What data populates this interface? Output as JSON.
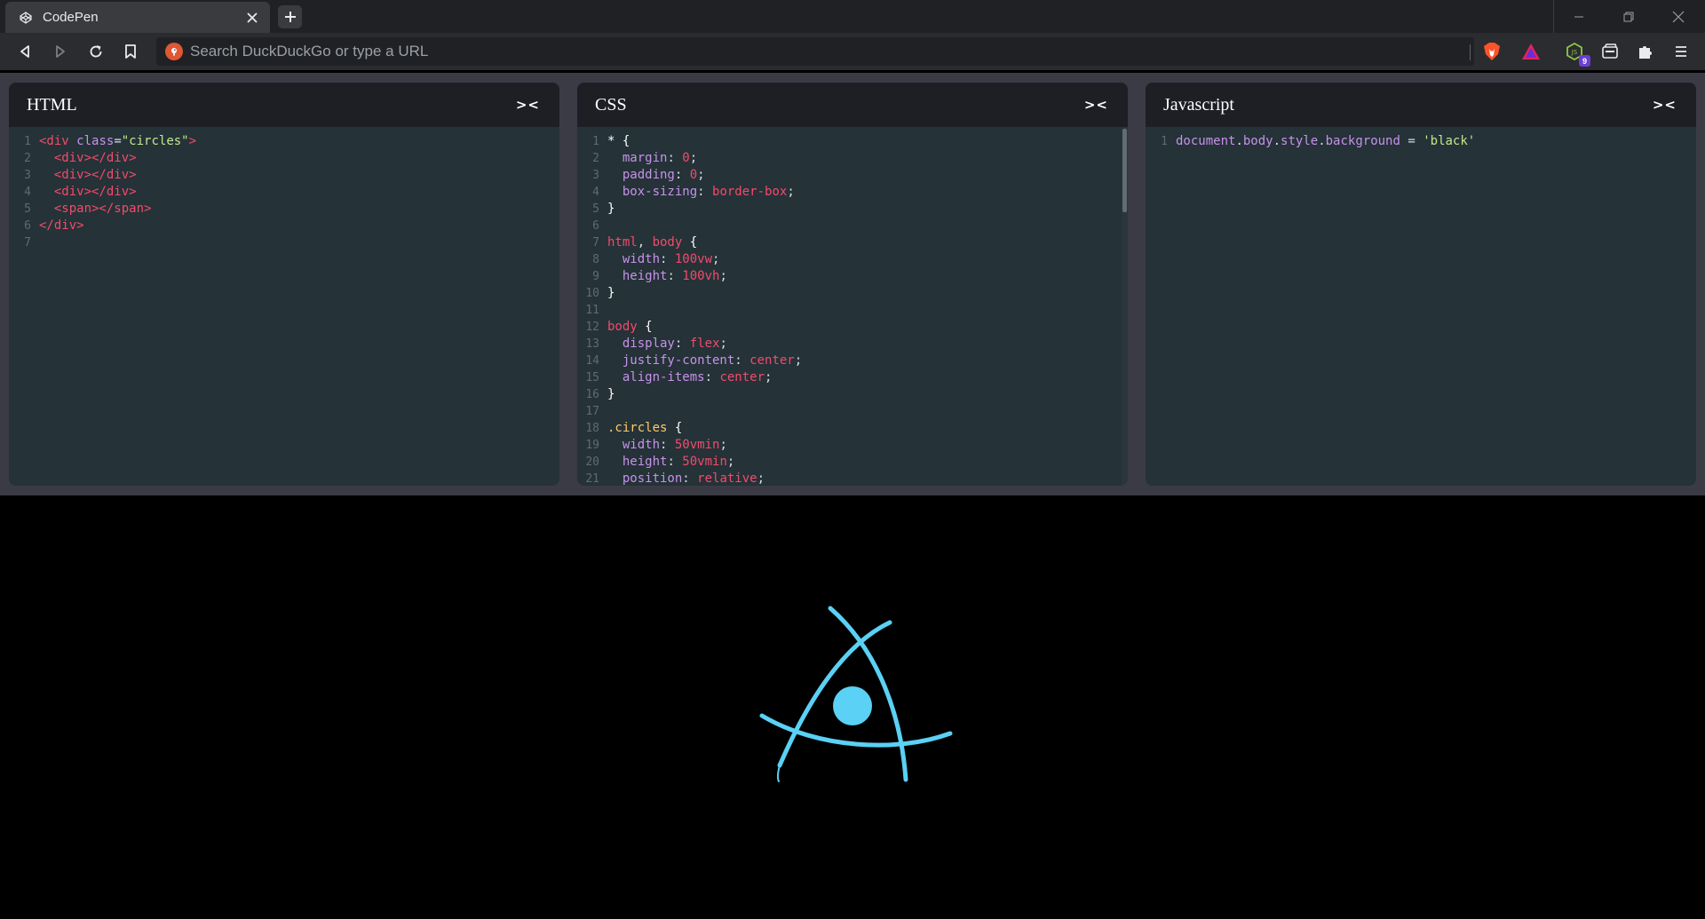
{
  "browser": {
    "tab": {
      "title": "CodePen",
      "favicon": "codepen-icon"
    },
    "url_placeholder": "Search DuckDuckGo or type a URL",
    "extension_badge": "9",
    "colors": {
      "tab_bg": "#3a3b3e",
      "toolbar_bg": "#2b2c2f",
      "tabbar_bg": "#202124"
    }
  },
  "panels": {
    "html": {
      "title": "HTML",
      "collapse_label": "><",
      "lines": [
        {
          "n": "1",
          "parts": [
            [
              "t-tag",
              "<div "
            ],
            [
              "t-attr",
              "class"
            ],
            [
              "t-pun",
              "="
            ],
            [
              "t-str",
              "\"circles\""
            ],
            [
              "t-tag",
              ">"
            ]
          ]
        },
        {
          "n": "2",
          "parts": [
            [
              "t-tag",
              "  <div></div>"
            ]
          ]
        },
        {
          "n": "3",
          "parts": [
            [
              "t-tag",
              "  <div></div>"
            ]
          ]
        },
        {
          "n": "4",
          "parts": [
            [
              "t-tag",
              "  <div></div>"
            ]
          ]
        },
        {
          "n": "5",
          "parts": [
            [
              "t-tag",
              "  <span></span>"
            ]
          ]
        },
        {
          "n": "6",
          "parts": [
            [
              "t-tag",
              "</div>"
            ]
          ]
        },
        {
          "n": "7",
          "parts": []
        }
      ]
    },
    "css": {
      "title": "CSS",
      "collapse_label": "><",
      "lines": [
        {
          "n": "1",
          "parts": [
            [
              "t-brace",
              "* {"
            ]
          ]
        },
        {
          "n": "2",
          "parts": [
            [
              "t-prop",
              "  margin"
            ],
            [
              "t-pun",
              ": "
            ],
            [
              "t-val",
              "0"
            ],
            [
              "t-pun",
              ";"
            ]
          ]
        },
        {
          "n": "3",
          "parts": [
            [
              "t-prop",
              "  padding"
            ],
            [
              "t-pun",
              ": "
            ],
            [
              "t-val",
              "0"
            ],
            [
              "t-pun",
              ";"
            ]
          ]
        },
        {
          "n": "4",
          "parts": [
            [
              "t-prop",
              "  box-sizing"
            ],
            [
              "t-pun",
              ": "
            ],
            [
              "t-val",
              "border-box"
            ],
            [
              "t-pun",
              ";"
            ]
          ]
        },
        {
          "n": "5",
          "parts": [
            [
              "t-brace",
              "}"
            ]
          ]
        },
        {
          "n": "6",
          "parts": []
        },
        {
          "n": "7",
          "parts": [
            [
              "t-sel",
              "html"
            ],
            [
              "t-pun",
              ", "
            ],
            [
              "t-sel",
              "body"
            ],
            [
              "t-brace",
              " {"
            ]
          ]
        },
        {
          "n": "8",
          "parts": [
            [
              "t-prop",
              "  width"
            ],
            [
              "t-pun",
              ": "
            ],
            [
              "t-val",
              "100vw"
            ],
            [
              "t-pun",
              ";"
            ]
          ]
        },
        {
          "n": "9",
          "parts": [
            [
              "t-prop",
              "  height"
            ],
            [
              "t-pun",
              ": "
            ],
            [
              "t-val",
              "100vh"
            ],
            [
              "t-pun",
              ";"
            ]
          ]
        },
        {
          "n": "10",
          "parts": [
            [
              "t-brace",
              "}"
            ]
          ]
        },
        {
          "n": "11",
          "parts": []
        },
        {
          "n": "12",
          "parts": [
            [
              "t-sel",
              "body"
            ],
            [
              "t-brace",
              " {"
            ]
          ]
        },
        {
          "n": "13",
          "parts": [
            [
              "t-prop",
              "  display"
            ],
            [
              "t-pun",
              ": "
            ],
            [
              "t-val",
              "flex"
            ],
            [
              "t-pun",
              ";"
            ]
          ]
        },
        {
          "n": "14",
          "parts": [
            [
              "t-prop",
              "  justify-content"
            ],
            [
              "t-pun",
              ": "
            ],
            [
              "t-val",
              "center"
            ],
            [
              "t-pun",
              ";"
            ]
          ]
        },
        {
          "n": "15",
          "parts": [
            [
              "t-prop",
              "  align-items"
            ],
            [
              "t-pun",
              ": "
            ],
            [
              "t-val",
              "center"
            ],
            [
              "t-pun",
              ";"
            ]
          ]
        },
        {
          "n": "16",
          "parts": [
            [
              "t-brace",
              "}"
            ]
          ]
        },
        {
          "n": "17",
          "parts": []
        },
        {
          "n": "18",
          "parts": [
            [
              "t-cls",
              ".circles"
            ],
            [
              "t-brace",
              " {"
            ]
          ]
        },
        {
          "n": "19",
          "parts": [
            [
              "t-prop",
              "  width"
            ],
            [
              "t-pun",
              ": "
            ],
            [
              "t-val",
              "50vmin"
            ],
            [
              "t-pun",
              ";"
            ]
          ]
        },
        {
          "n": "20",
          "parts": [
            [
              "t-prop",
              "  height"
            ],
            [
              "t-pun",
              ": "
            ],
            [
              "t-val",
              "50vmin"
            ],
            [
              "t-pun",
              ";"
            ]
          ]
        },
        {
          "n": "21",
          "parts": [
            [
              "t-prop",
              "  position"
            ],
            [
              "t-pun",
              ": "
            ],
            [
              "t-val",
              "relative"
            ],
            [
              "t-pun",
              ";"
            ]
          ]
        }
      ]
    },
    "js": {
      "title": "Javascript",
      "collapse_label": "><",
      "lines": [
        {
          "n": "1",
          "parts": [
            [
              "t-js",
              "document"
            ],
            [
              "t-pun",
              "."
            ],
            [
              "t-js",
              "body"
            ],
            [
              "t-pun",
              "."
            ],
            [
              "t-js",
              "style"
            ],
            [
              "t-pun",
              "."
            ],
            [
              "t-js",
              "background"
            ],
            [
              "t-pun",
              " = "
            ],
            [
              "t-str",
              "'black'"
            ]
          ]
        }
      ]
    }
  },
  "preview": {
    "background": "#000000",
    "accent": "#5ad1f5"
  }
}
